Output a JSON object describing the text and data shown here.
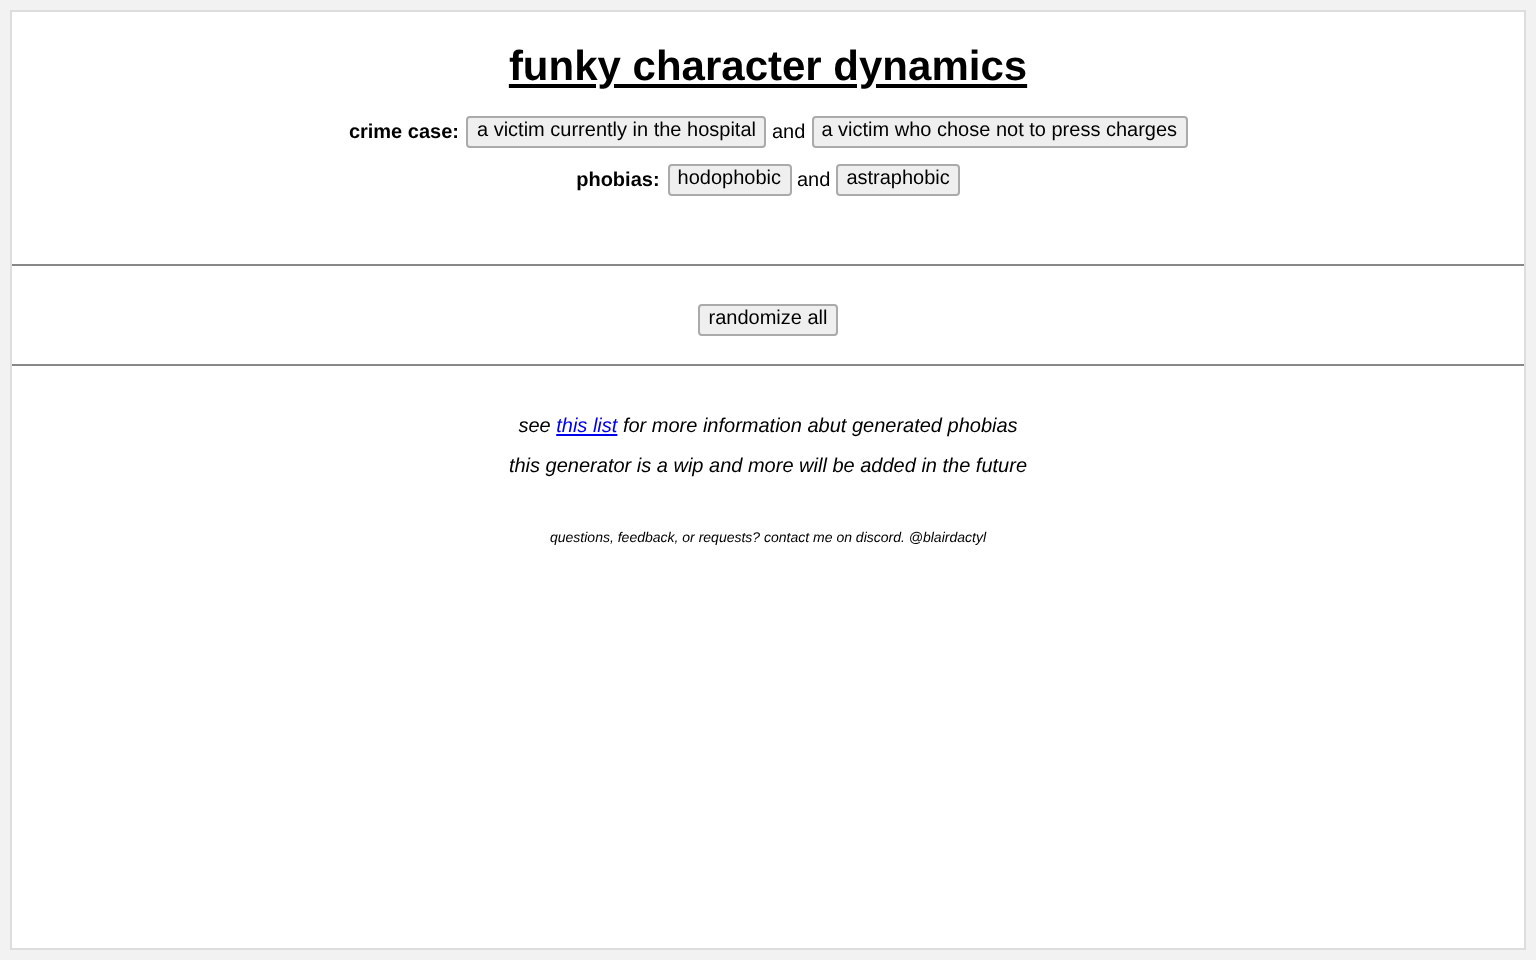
{
  "title": "funky character dynamics",
  "rows": [
    {
      "label": "crime case:",
      "options": [
        "a victim currently in the hospital",
        "a victim who chose not to press charges"
      ],
      "joiner": "and"
    },
    {
      "label": "phobias:",
      "options": [
        "hodophobic",
        "astraphobic"
      ],
      "joiner": "and"
    }
  ],
  "randomize_button": "randomize all",
  "info": {
    "before": "see",
    "link": "this list",
    "after": "for more information abut generated phobias"
  },
  "note": "this generator is a wip and more will be added in the future",
  "contact": "questions, feedback, or requests? contact me on discord. @blairdactyl"
}
